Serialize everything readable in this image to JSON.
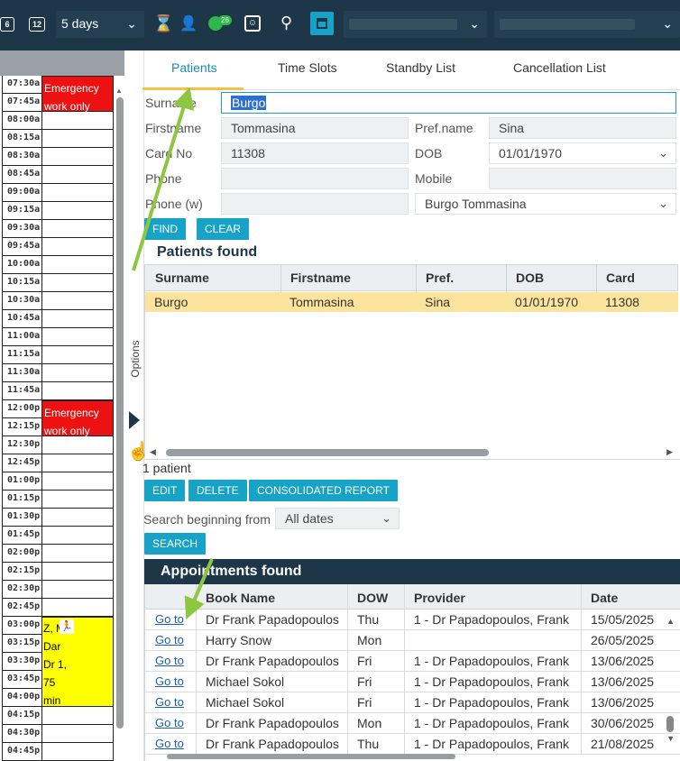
{
  "toolbar": {
    "back_icon": "6",
    "fwd_icon": "12",
    "days_dropdown": "5 days",
    "badge_count": "26",
    "icons": [
      "prev-week-icon",
      "next-week-icon",
      "hourglass-icon",
      "user-settings-icon",
      "phone-check-icon",
      "face-icon",
      "search-icon",
      "calendar-icon"
    ]
  },
  "schedule": {
    "times": [
      "07:30a",
      "07:45a",
      "08:00a",
      "08:15a",
      "08:30a",
      "08:45a",
      "09:00a",
      "09:15a",
      "09:30a",
      "09:45a",
      "10:00a",
      "10:15a",
      "10:30a",
      "10:45a",
      "11:00a",
      "11:15a",
      "11:30a",
      "11:45a",
      "12:00p",
      "12:15p",
      "12:30p",
      "12:45p",
      "01:00p",
      "01:15p",
      "01:30p",
      "01:45p",
      "02:00p",
      "02:15p",
      "02:30p",
      "02:45p",
      "03:00p",
      "03:15p",
      "03:30p",
      "03:45p",
      "04:00p",
      "04:15p",
      "04:30p",
      "04:45p"
    ],
    "emergency_label_1": "Emergency",
    "emergency_label_2": "work only",
    "appt_lines": [
      "Z, M",
      "Dar",
      "Dr 1,",
      "75",
      "min"
    ]
  },
  "options_label": "Options",
  "tabs": [
    "Patients",
    "Time Slots",
    "Standby List",
    "Cancellation List"
  ],
  "form": {
    "surname_label": "Surname",
    "surname_value": "Burgo",
    "firstname_label": "Firstname",
    "firstname_value": "Tommasina",
    "prefname_label": "Pref.name",
    "prefname_value": "Sina",
    "cardno_label": "Card No",
    "cardno_value": "11308",
    "dob_label": "DOB",
    "dob_value": "01/01/1970",
    "phone_label": "Phone",
    "phone_value": "",
    "mobile_label": "Mobile",
    "mobile_value": "",
    "phonew_label": "Phone (w)",
    "phonew_value": "",
    "name_select": "Burgo Tommasina"
  },
  "buttons": {
    "find": "FIND",
    "clear": "CLEAR",
    "edit": "EDIT",
    "delete": "DELETE",
    "consolidated": "CONSOLIDATED REPORT",
    "search": "SEARCH"
  },
  "patients_found": {
    "title": "Patients found",
    "headers": [
      "Surname",
      "Firstname",
      "Pref.",
      "DOB",
      "Card"
    ],
    "row": [
      "Burgo",
      "Tommasina",
      "Sina",
      "01/01/1970",
      "11308"
    ],
    "count": "1 patient"
  },
  "search_from": {
    "label": "Search beginning from",
    "value": "All dates"
  },
  "appointments": {
    "title": "Appointments found",
    "headers": [
      "Book Name",
      "DOW",
      "Provider",
      "Date"
    ],
    "goto": "Go to",
    "rows": [
      [
        "Dr Frank Papadopoulos",
        "Thu",
        "1 - Dr Papadopoulos, Frank",
        "15/05/2025"
      ],
      [
        "Harry Snow",
        "Mon",
        "",
        "26/05/2025"
      ],
      [
        "Dr Frank Papadopoulos",
        "Fri",
        "1 - Dr Papadopoulos, Frank",
        "13/06/2025"
      ],
      [
        "Michael Sokol",
        "Fri",
        "1 - Dr Papadopoulos, Frank",
        "13/06/2025"
      ],
      [
        "Michael Sokol",
        "Fri",
        "1 - Dr Papadopoulos, Frank",
        "13/06/2025"
      ],
      [
        "Dr Frank Papadopoulos",
        "Mon",
        "1 - Dr Papadopoulos, Frank",
        "30/06/2025"
      ],
      [
        "Dr Frank Papadopoulos",
        "Thu",
        "1 - Dr Papadopoulos, Frank",
        "21/08/2025"
      ]
    ]
  },
  "colors": {
    "topbar": "#1d3748",
    "accent": "#17a3c7",
    "emergency": "#ee1111",
    "highlight_row": "#fde49c",
    "arrow": "#8dc63f"
  }
}
